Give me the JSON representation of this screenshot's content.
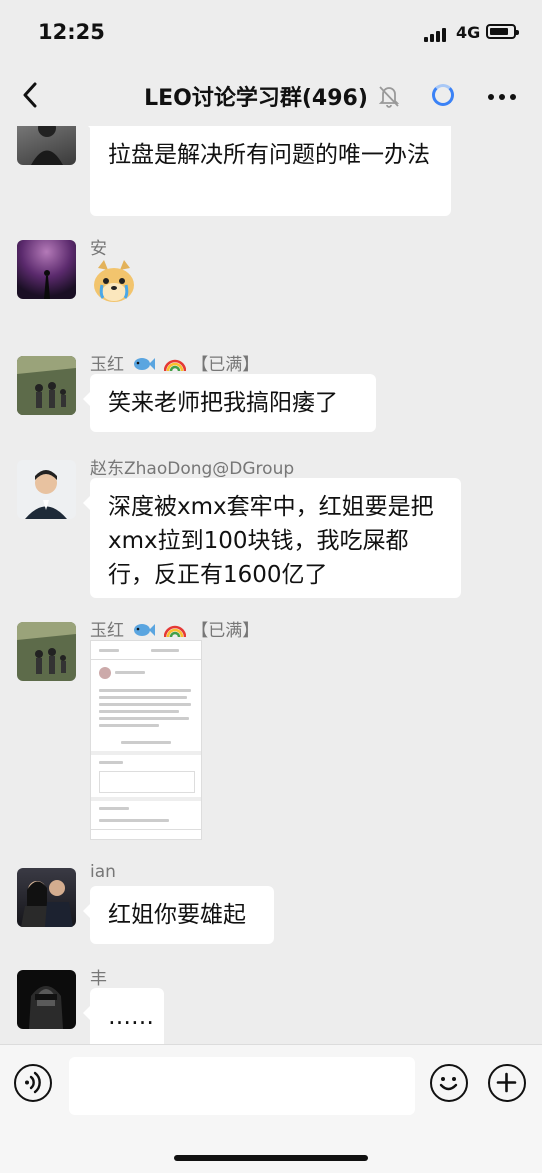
{
  "status": {
    "time": "12:25",
    "network": "4G"
  },
  "header": {
    "title": "LEO讨论学习群(496)"
  },
  "messages": [
    {
      "name": "",
      "text": "拉盘是解决所有问题的唯一办法"
    },
    {
      "name": "安",
      "text": ""
    },
    {
      "name": "玉红",
      "badge": "【已满】",
      "text": "笑来老师把我搞阳痿了"
    },
    {
      "name": "赵东ZhaoDong@DGroup",
      "text": "深度被xmx套牢中，红姐要是把xmx拉到100块钱，我吃屎都行，反正有1600亿了"
    },
    {
      "name": "玉红",
      "badge": "【已满】",
      "text": ""
    },
    {
      "name": "ian",
      "text": "红姐你要雄起"
    },
    {
      "name": "丰",
      "text": "……"
    }
  ]
}
